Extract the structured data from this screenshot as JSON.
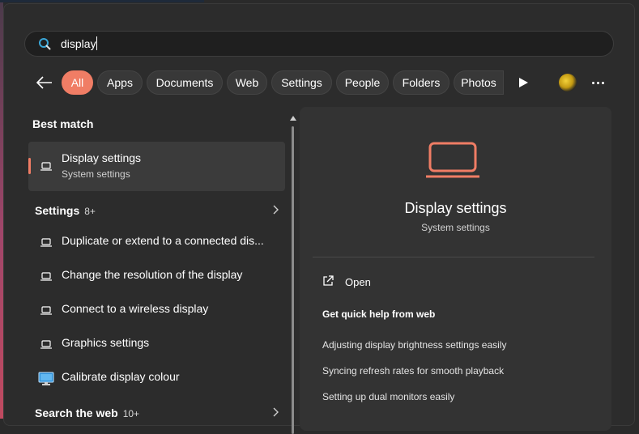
{
  "search": {
    "value": "display"
  },
  "filters": {
    "back_icon": "arrow-left-icon",
    "chips": [
      {
        "label": "All",
        "active": true
      },
      {
        "label": "Apps"
      },
      {
        "label": "Documents"
      },
      {
        "label": "Web"
      },
      {
        "label": "Settings"
      },
      {
        "label": "People"
      },
      {
        "label": "Folders"
      },
      {
        "label": "Photos"
      }
    ],
    "more_icon": "ellipsis-icon",
    "play_icon": "play-icon"
  },
  "results": {
    "best_match_heading": "Best match",
    "best_match": {
      "title": "Display settings",
      "subtitle": "System settings",
      "icon": "laptop-icon"
    },
    "settings_heading": "Settings",
    "settings_count": "8+",
    "settings_items": [
      {
        "label": "Duplicate or extend to a connected dis...",
        "icon": "laptop-icon"
      },
      {
        "label": "Change the resolution of the display",
        "icon": "laptop-icon"
      },
      {
        "label": "Connect to a wireless display",
        "icon": "laptop-icon"
      },
      {
        "label": "Graphics settings",
        "icon": "laptop-icon"
      },
      {
        "label": "Calibrate display colour",
        "icon": "monitor-color-icon"
      }
    ],
    "web_heading": "Search the web",
    "web_count": "10+"
  },
  "preview": {
    "title": "Display settings",
    "subtitle": "System settings",
    "open_label": "Open",
    "help_heading": "Get quick help from web",
    "help_links": [
      "Adjusting display brightness settings easily",
      "Syncing refresh rates for smooth playback",
      "Setting up dual monitors easily"
    ]
  },
  "colors": {
    "accent": "#f07d65",
    "panel": "#2c2c2c",
    "preview_bg": "#333333"
  }
}
